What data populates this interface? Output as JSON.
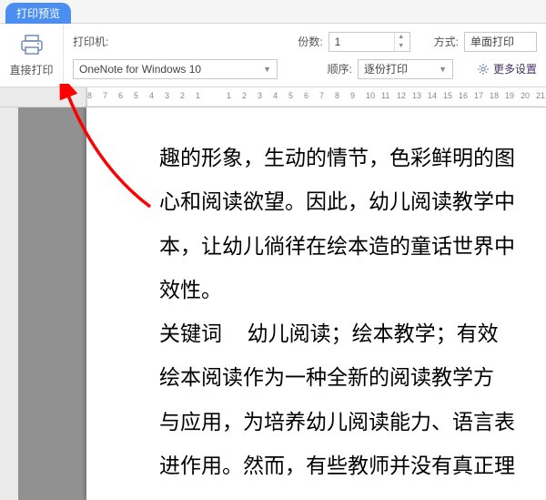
{
  "tab": {
    "label": "打印预览"
  },
  "printBtn": {
    "label": "直接打印"
  },
  "printerLabel": "打印机:",
  "printerValue": "OneNote for Windows 10",
  "copiesLabel": "份数:",
  "copiesValue": "1",
  "modeLabel": "方式:",
  "modeValue": "单面打印",
  "orderLabel": "顺序:",
  "orderValue": "逐份打印",
  "moreSettings": "更多设置",
  "ruler": [
    "8",
    "7",
    "6",
    "5",
    "4",
    "3",
    "2",
    "1",
    "",
    "1",
    "2",
    "3",
    "4",
    "5",
    "6",
    "7",
    "8",
    "9",
    "10",
    "11",
    "12",
    "13",
    "14",
    "15",
    "16",
    "17",
    "18",
    "19",
    "20",
    "21"
  ],
  "doc": {
    "l1": "趣的形象，生动的情节，色彩鲜明的图",
    "l2": "心和阅读欲望。因此，幼儿阅读教学中",
    "l3": "本，让幼儿徜徉在绘本造的童话世界中",
    "l4": "效性。",
    "l5a": "关键词",
    "l5b": "幼儿阅读；绘本教学；有效",
    "l6": "绘本阅读作为一种全新的阅读教学方",
    "l7": "与应用，为培养幼儿阅读能力、语言表",
    "l8": "进作用。然而，有些教师并没有真正理"
  }
}
